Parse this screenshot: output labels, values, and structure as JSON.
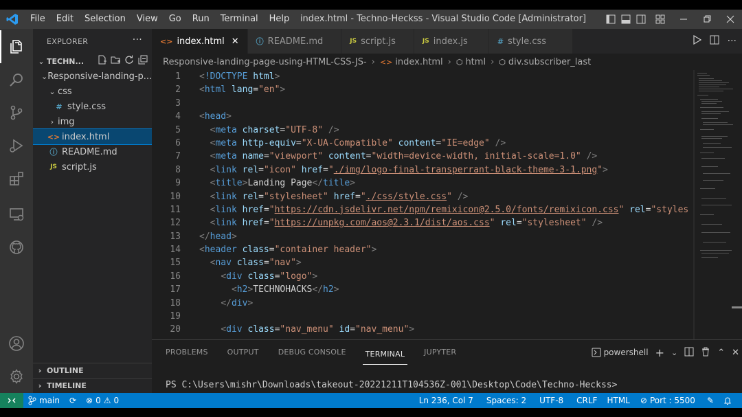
{
  "window": {
    "title": "index.html - Techno-Heckss - Visual Studio Code [Administrator]",
    "menu": [
      "File",
      "Edit",
      "Selection",
      "View",
      "Go",
      "Run",
      "Terminal",
      "Help"
    ]
  },
  "explorer": {
    "header": "EXPLORER",
    "root": "TECHN...",
    "project": "Responsive-landing-p...",
    "items": [
      {
        "label": "css",
        "type": "folder-open"
      },
      {
        "label": "style.css",
        "type": "css"
      },
      {
        "label": "img",
        "type": "folder"
      },
      {
        "label": "index.html",
        "type": "html"
      },
      {
        "label": "README.md",
        "type": "info"
      },
      {
        "label": "script.js",
        "type": "js"
      }
    ],
    "outline": "OUTLINE",
    "timeline": "TIMELINE"
  },
  "tabs": [
    {
      "label": "index.html",
      "icon": "<>",
      "active": true
    },
    {
      "label": "README.md",
      "icon": "ⓘ"
    },
    {
      "label": "script.js",
      "icon": "JS"
    },
    {
      "label": "index.js",
      "icon": "JS"
    },
    {
      "label": "style.css",
      "icon": "#"
    }
  ],
  "breadcrumb": [
    "Responsive-landing-page-using-HTML-CSS-JS-",
    "index.html",
    "html",
    "div.subscriber_last"
  ],
  "code": {
    "line_numbers": [
      "1",
      "2",
      "3",
      "4",
      "5",
      "6",
      "7",
      "8",
      "9",
      "10",
      "11",
      "12",
      "13",
      "14",
      "15",
      "16",
      "17",
      "18",
      "19",
      "20"
    ]
  },
  "panel": {
    "tabs": [
      "PROBLEMS",
      "OUTPUT",
      "DEBUG CONSOLE",
      "TERMINAL",
      "JUPYTER"
    ],
    "active_tab": "TERMINAL",
    "shell": "powershell",
    "prompt": "PS C:\\Users\\mishr\\Downloads\\takeout-20221211T104536Z-001\\Desktop\\Code\\Techno-Heckss>"
  },
  "status": {
    "branch": "main",
    "errors": "0",
    "warnings": "0",
    "position": "Ln 236, Col 7",
    "spaces": "Spaces: 2",
    "encoding": "UTF-8",
    "eol": "CRLF",
    "language": "HTML",
    "port": "Port : 5500"
  },
  "colors": {
    "accent": "#007acc",
    "activity": "#333333",
    "sidebar": "#252526",
    "editor": "#1e1e1e"
  }
}
